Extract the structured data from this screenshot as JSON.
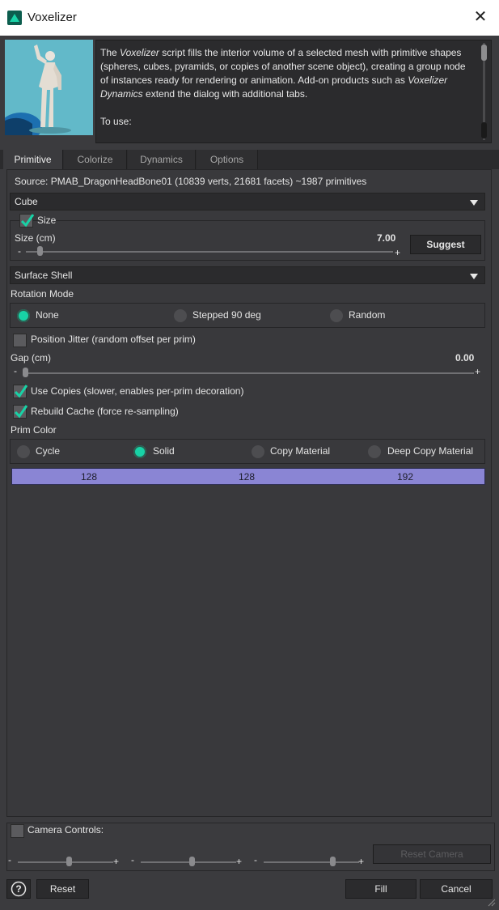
{
  "window": {
    "title": "Voxelizer"
  },
  "description": {
    "p1_a": "The ",
    "p1_em1": "Voxelizer",
    "p1_b": " script fills the interior volume of a selected mesh with primitive shapes (spheres, cubes, pyramids, or copies of another scene object), creating a group node of instances ready for rendering or animation. Add-on products such as ",
    "p1_em2": "Voxelizer Dynamics",
    "p1_c": " extend the dialog with additional tabs.",
    "p2": "To use:"
  },
  "tabs": [
    "Primitive",
    "Colorize",
    "Dynamics",
    "Options"
  ],
  "primitive": {
    "source": "Source: PMAB_DragonHeadBone01 (10839 verts, 21681 facets)  ~1987 primitives",
    "shape": "Cube",
    "size_check_label": "Size",
    "size_label": "Size (cm)",
    "size_value": "7.00",
    "size_fraction": 0.03,
    "suggest": "Suggest",
    "fill_mode": "Surface Shell",
    "rotation_mode_label": "Rotation Mode",
    "rotation_options": [
      "None",
      "Stepped 90 deg",
      "Random"
    ],
    "rotation_selected": "None",
    "jitter_label": "Position Jitter (random offset per prim)",
    "gap_label": "Gap (cm)",
    "gap_value": "0.00",
    "gap_fraction": 0.0,
    "use_copies_label": "Use Copies (slower, enables per-prim decoration)",
    "rebuild_label": "Rebuild Cache (force re-sampling)",
    "prim_color_label": "Prim Color",
    "color_options": [
      "Cycle",
      "Solid",
      "Copy Material",
      "Deep Copy Material"
    ],
    "color_selected": "Solid",
    "rgb": [
      "128",
      "128",
      "192"
    ],
    "rgb_color": "#8a85d4"
  },
  "camera": {
    "label": "Camera Controls:",
    "minus": "-",
    "plus": "+",
    "reset": "Reset Camera"
  },
  "footer": {
    "help": "?",
    "reset": "Reset",
    "fill": "Fill",
    "cancel": "Cancel"
  },
  "colors": {
    "accent": "#18d2a6",
    "background": "#3b3b3e"
  }
}
